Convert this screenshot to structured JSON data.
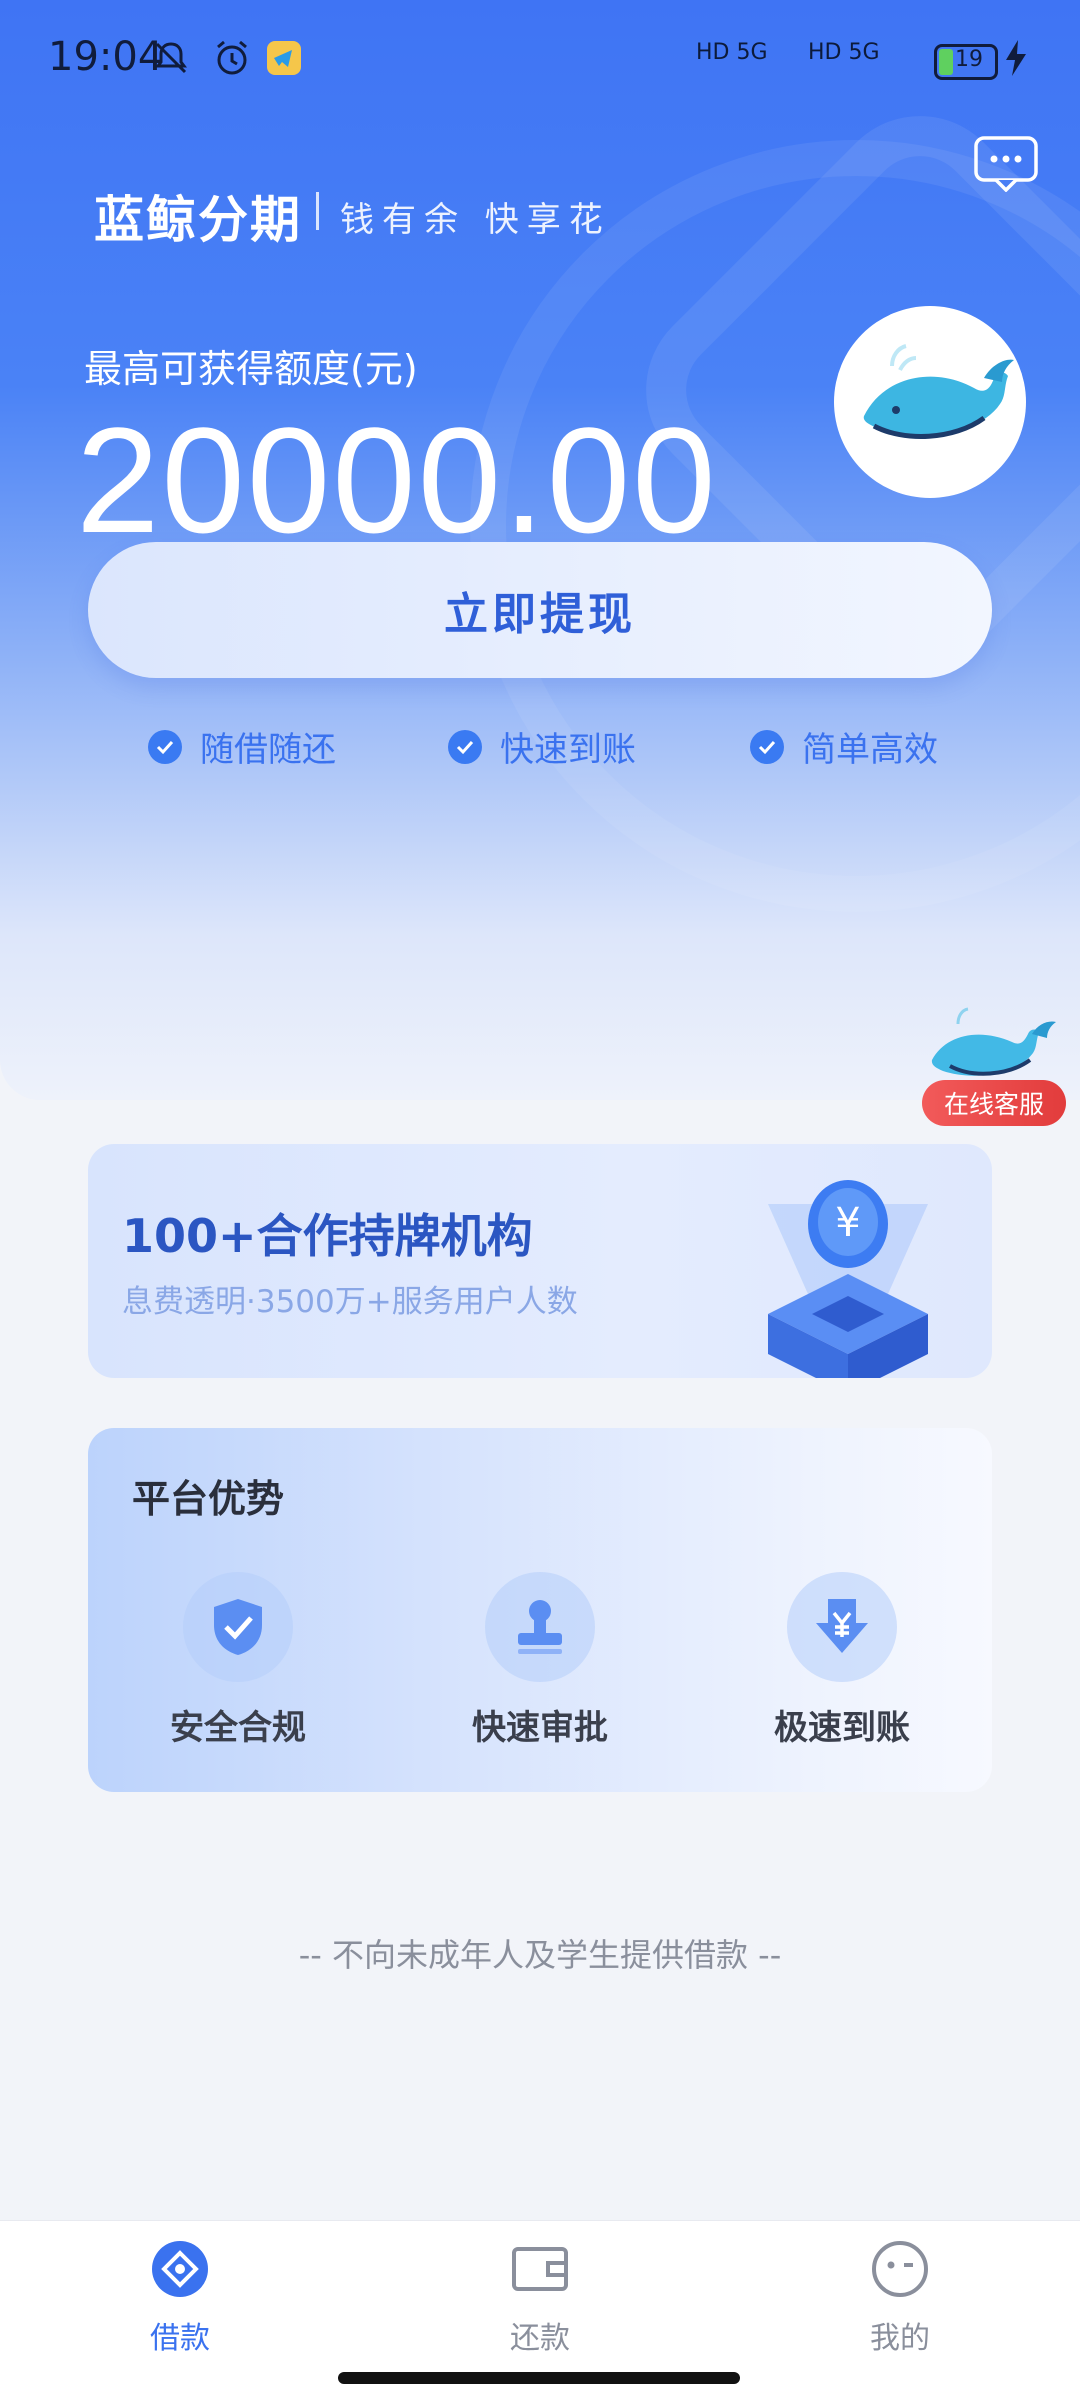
{
  "status_bar": {
    "time": "19:04",
    "battery": "19",
    "signal_1": "HD 5G",
    "signal_2": "HD 5G"
  },
  "header": {
    "brand": "蓝鲸分期",
    "slogan": "钱有余 快享花"
  },
  "quota": {
    "label": "最高可获得额度(元)",
    "amount": "20000.00"
  },
  "cta": {
    "label": "立即提现"
  },
  "features": [
    {
      "label": "随借随还"
    },
    {
      "label": "快速到账"
    },
    {
      "label": "简单高效"
    }
  ],
  "customer_service": {
    "label": "在线客服"
  },
  "partner": {
    "title": "100+合作持牌机构",
    "subtitle": "息费透明·3500万+服务用户人数"
  },
  "advantages": {
    "title": "平台优势",
    "items": [
      {
        "label": "安全合规",
        "icon": "shield-check-icon"
      },
      {
        "label": "快速审批",
        "icon": "stamp-icon"
      },
      {
        "label": "极速到账",
        "icon": "yuan-down-arrow-icon"
      }
    ]
  },
  "disclaimer": "-- 不向未成年人及学生提供借款 --",
  "tabs": [
    {
      "label": "借款",
      "active": true,
      "icon": "loan-icon"
    },
    {
      "label": "还款",
      "active": false,
      "icon": "wallet-icon"
    },
    {
      "label": "我的",
      "active": false,
      "icon": "profile-icon"
    }
  ],
  "colors": {
    "primary": "#3a72ef",
    "hero_top": "#3f74f4",
    "badge_red": "#e23c3c",
    "tab_active": "#3a72ef",
    "tab_inactive": "#8a8f9c"
  }
}
